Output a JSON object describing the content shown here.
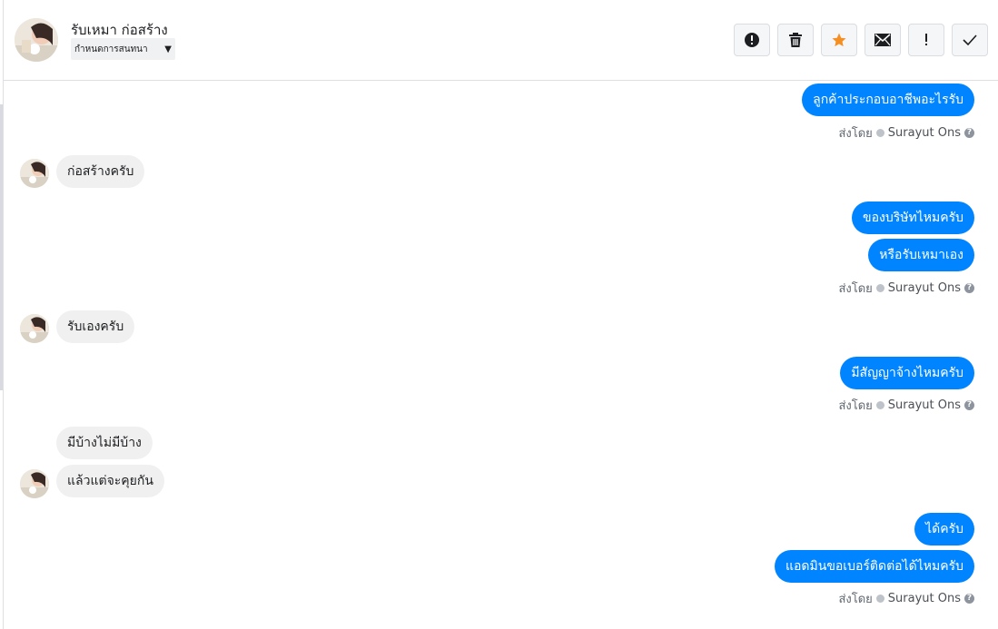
{
  "header": {
    "contact_name": "รับเหมา ก่อสร้าง",
    "label_select": "กำหนดการสนทนา",
    "actions": [
      "mark-spam",
      "delete",
      "star",
      "mark-unread",
      "follow-up",
      "mark-done"
    ]
  },
  "messages": [
    {
      "dir": "out",
      "text": "ลูกค้าประกอบอาชีพอะไรรับ"
    },
    {
      "dir": "in",
      "text": "ก่อสร้างครับ"
    },
    {
      "dir": "out",
      "text": "ของบริษัทไหมครับ"
    },
    {
      "dir": "out",
      "text": "หรือรับเหมาเอง"
    },
    {
      "dir": "in",
      "text": "รับเองครับ"
    },
    {
      "dir": "out",
      "text": "มีสัญญาจ้างไหมครับ"
    },
    {
      "dir": "in",
      "text": "มีบ้างไม่มีบ้าง"
    },
    {
      "dir": "in",
      "text": "แล้วแต่จะคุยกัน"
    },
    {
      "dir": "out",
      "text": "ได้ครับ"
    },
    {
      "dir": "out",
      "text": "แอดมินขอเบอร์ติดต่อได้ไหมครับ"
    }
  ],
  "sent_by": {
    "prefix": "ส่งโดย",
    "agent": "Surayut Ons"
  },
  "colors": {
    "outgoing": "#0084ff",
    "incoming": "#f1f0f0",
    "star": "#f68f22"
  }
}
